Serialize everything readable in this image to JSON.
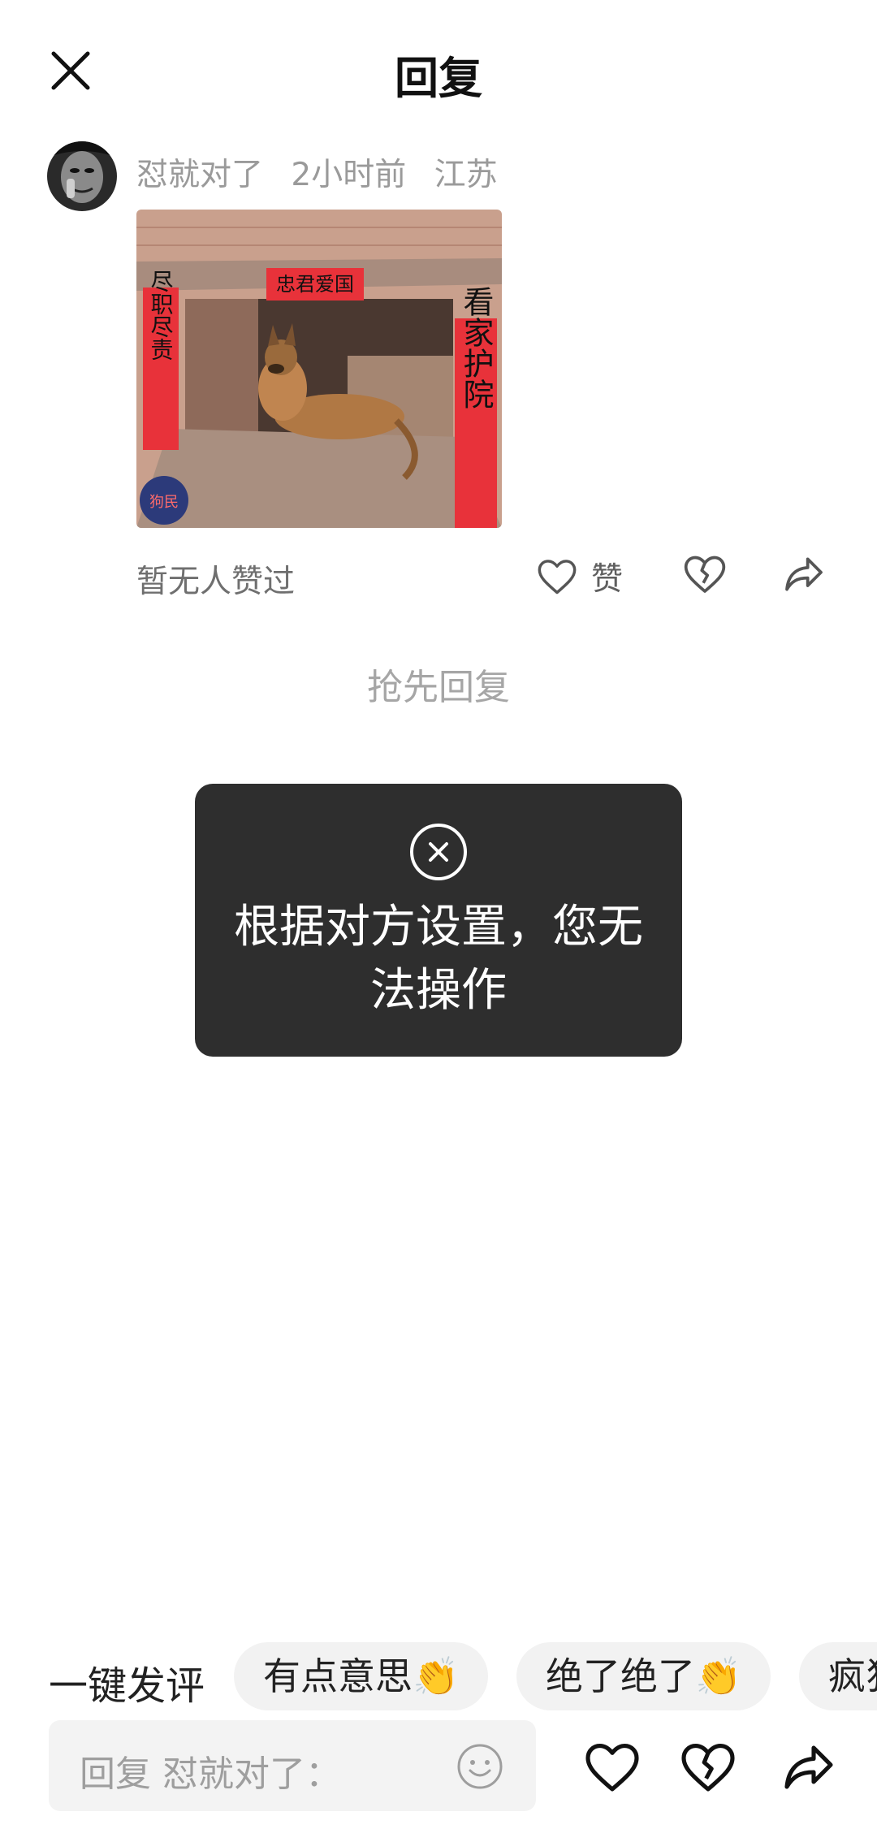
{
  "header": {
    "title": "回复",
    "close_icon": "close-icon"
  },
  "comment": {
    "username": "怼就对了",
    "time": "2小时前",
    "location": "江苏",
    "image_signs": {
      "top": "忠君爱国",
      "left": "尽职尽责",
      "right": "看家护院",
      "stamp": "狗民"
    },
    "likes_text": "暂无人赞过",
    "like_label": "赞",
    "icons": [
      "heart-icon",
      "broken-heart-icon",
      "share-icon"
    ]
  },
  "first_reply": "抢先回复",
  "toast": {
    "icon": "close-circle-icon",
    "message": "根据对方设置，您无法操作"
  },
  "quick_comment": {
    "label": "一键发评",
    "chips": [
      "有点意思👏",
      "绝了绝了👏",
      "疯狂"
    ]
  },
  "bottom_bar": {
    "placeholder": "回复 怼就对了：",
    "icons": [
      "emoji-icon",
      "heart-icon",
      "broken-heart-icon",
      "share-icon"
    ]
  },
  "colors": {
    "toast_bg": "#2e2e2e",
    "chip_bg": "#f2f2f2",
    "input_bg": "#f3f3f3",
    "sign_red": "#e8323a"
  }
}
